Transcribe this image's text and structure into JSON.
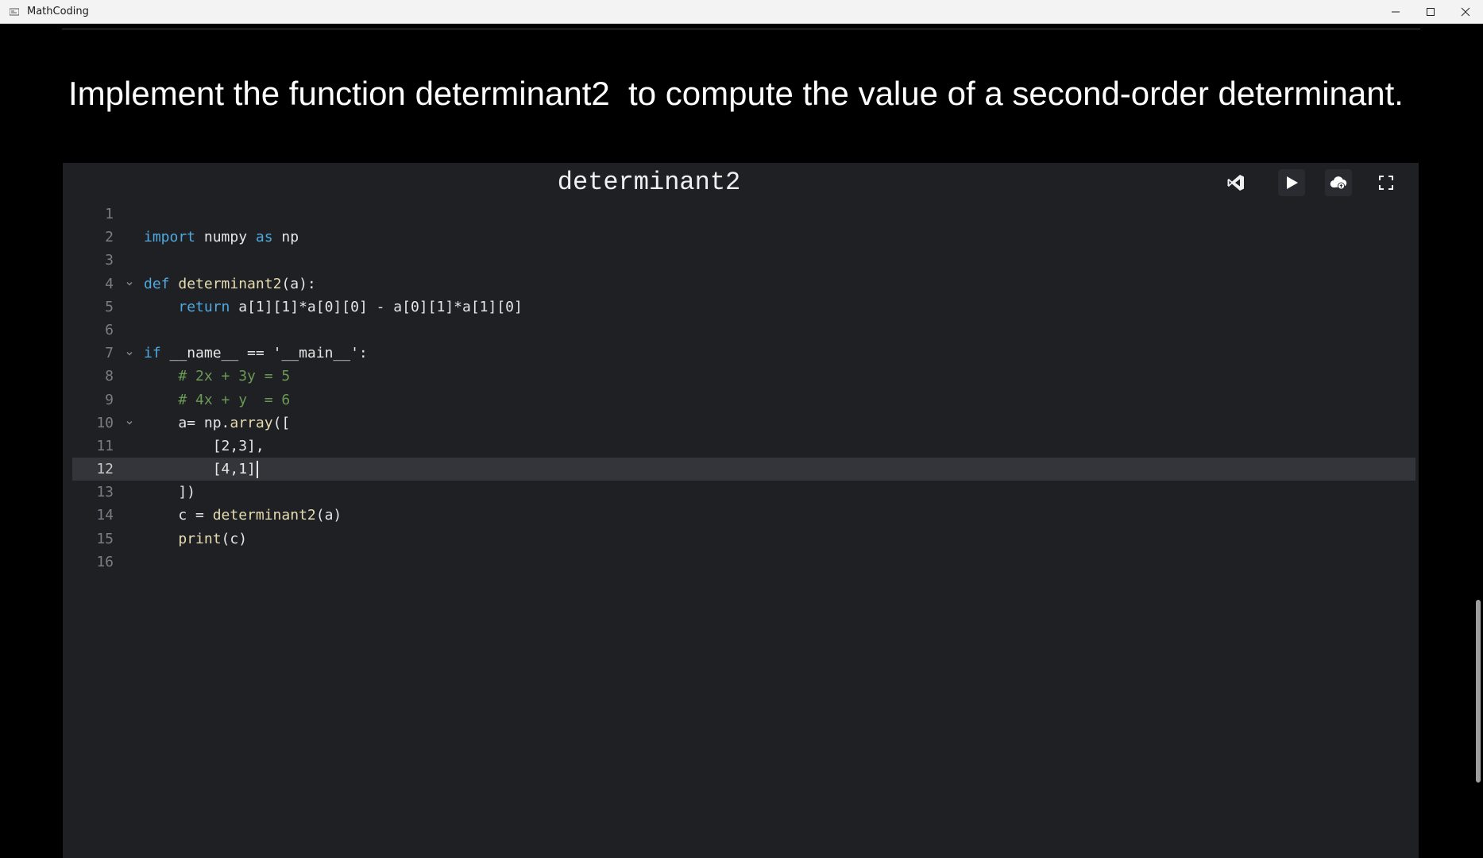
{
  "window": {
    "title": "MathCoding"
  },
  "question": {
    "text": "Implement the function determinant2  to compute the value of a second-order determinant."
  },
  "editor": {
    "title": "determinant2",
    "toolbar": {
      "vscode_icon": "vscode-icon",
      "run_icon": "play-icon",
      "upload_icon": "cloud-upload-icon",
      "fullscreen_icon": "fullscreen-icon"
    },
    "active_line": 12,
    "lines": [
      {
        "n": "1",
        "fold": false,
        "tokens": []
      },
      {
        "n": "2",
        "fold": false,
        "tokens": [
          [
            "kw",
            "import"
          ],
          [
            "p",
            " numpy "
          ],
          [
            "kw",
            "as"
          ],
          [
            "p",
            " np"
          ]
        ]
      },
      {
        "n": "3",
        "fold": false,
        "tokens": []
      },
      {
        "n": "4",
        "fold": true,
        "tokens": [
          [
            "kw",
            "def"
          ],
          [
            "p",
            " "
          ],
          [
            "fn",
            "determinant2"
          ],
          [
            "p",
            "(a):"
          ]
        ]
      },
      {
        "n": "5",
        "fold": false,
        "tokens": [
          [
            "p",
            "    "
          ],
          [
            "kw",
            "return"
          ],
          [
            "p",
            " a[1][1]*a[0][0] - a[0][1]*a[1][0]"
          ]
        ]
      },
      {
        "n": "6",
        "fold": false,
        "tokens": []
      },
      {
        "n": "7",
        "fold": true,
        "tokens": [
          [
            "kw",
            "if"
          ],
          [
            "p",
            " __name__ == '__main__':"
          ]
        ]
      },
      {
        "n": "8",
        "fold": false,
        "tokens": [
          [
            "p",
            "    "
          ],
          [
            "cm",
            "# 2x + 3y = 5"
          ]
        ]
      },
      {
        "n": "9",
        "fold": false,
        "tokens": [
          [
            "p",
            "    "
          ],
          [
            "cm",
            "# 4x + y  = 6"
          ]
        ]
      },
      {
        "n": "10",
        "fold": true,
        "tokens": [
          [
            "p",
            "    a= np."
          ],
          [
            "fn",
            "array"
          ],
          [
            "p",
            "(["
          ]
        ]
      },
      {
        "n": "11",
        "fold": false,
        "tokens": [
          [
            "p",
            "        [2,3],"
          ]
        ]
      },
      {
        "n": "12",
        "fold": false,
        "tokens": [
          [
            "p",
            "        [4,1]"
          ]
        ]
      },
      {
        "n": "13",
        "fold": false,
        "tokens": [
          [
            "p",
            "    ])"
          ]
        ]
      },
      {
        "n": "14",
        "fold": false,
        "tokens": [
          [
            "p",
            "    c = "
          ],
          [
            "fn",
            "determinant2"
          ],
          [
            "p",
            "(a)"
          ]
        ]
      },
      {
        "n": "15",
        "fold": false,
        "tokens": [
          [
            "p",
            "    "
          ],
          [
            "fn",
            "print"
          ],
          [
            "p",
            "(c)"
          ]
        ]
      },
      {
        "n": "16",
        "fold": false,
        "tokens": []
      }
    ]
  }
}
